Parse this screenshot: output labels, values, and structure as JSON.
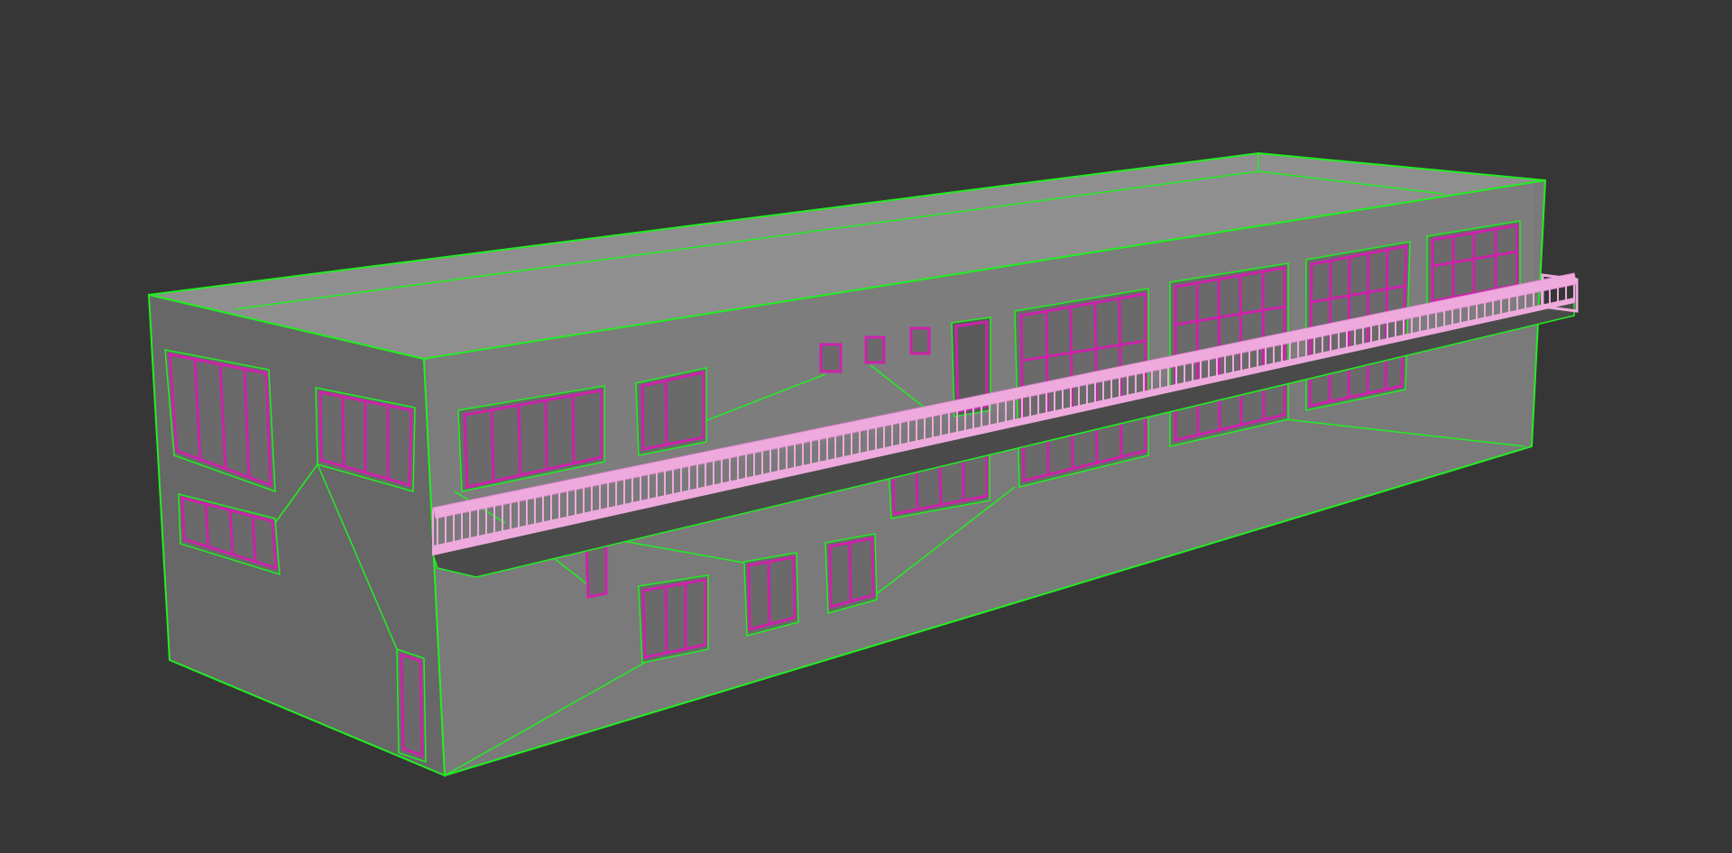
{
  "viewport": {
    "background": "#363636",
    "colors": {
      "wireframe": "#22ee22",
      "facade": "#7a7a7a",
      "facade_dark": "#6a6a6a",
      "side": "#656565",
      "roof": "#8a8a8a",
      "window_frame": "#cc22aa",
      "railing": "#eeaadd"
    },
    "model": "building-wireframe"
  }
}
